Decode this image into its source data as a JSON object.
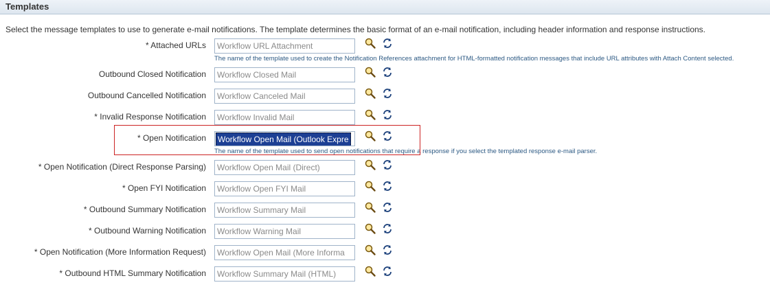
{
  "section_title": "Templates",
  "description": "Select the message templates to use to generate e-mail notifications. The template determines the basic format of an e-mail notification, including header information and response instructions.",
  "rows": [
    {
      "label": "* Attached URLs",
      "value": "Workflow URL Attachment",
      "hint": "The name of the template used to create the Notification References attachment for HTML-formatted notification messages that include URL attributes with Attach Content selected."
    },
    {
      "label": "Outbound Closed Notification",
      "value": "Workflow Closed Mail"
    },
    {
      "label": "Outbound Cancelled Notification",
      "value": "Workflow Canceled Mail"
    },
    {
      "label": "* Invalid Response Notification",
      "value": "Workflow Invalid Mail"
    },
    {
      "label": "* Open Notification",
      "value": "Workflow Open Mail (Outlook Expre",
      "hint": "The name of the template used to send open notifications that require a response if you select the templated response e-mail parser."
    },
    {
      "label": "* Open Notification (Direct Response Parsing)",
      "value": "Workflow Open Mail (Direct)"
    },
    {
      "label": "* Open FYI Notification",
      "value": "Workflow Open FYI Mail"
    },
    {
      "label": "* Outbound Summary Notification",
      "value": "Workflow Summary Mail"
    },
    {
      "label": "* Outbound Warning Notification",
      "value": "Workflow Warning Mail"
    },
    {
      "label": "* Open Notification (More Information Request)",
      "value": "Workflow Open Mail (More Informa"
    },
    {
      "label": "* Outbound HTML Summary Notification",
      "value": "Workflow Summary Mail (HTML)"
    }
  ],
  "icons": {
    "search": "magnifier-search-icon",
    "refresh": "refresh-icon"
  },
  "colors": {
    "header_bg": "#dde6ef",
    "hint": "#2c5983",
    "highlight": "#cc2222",
    "selection": "#1c3f94"
  }
}
